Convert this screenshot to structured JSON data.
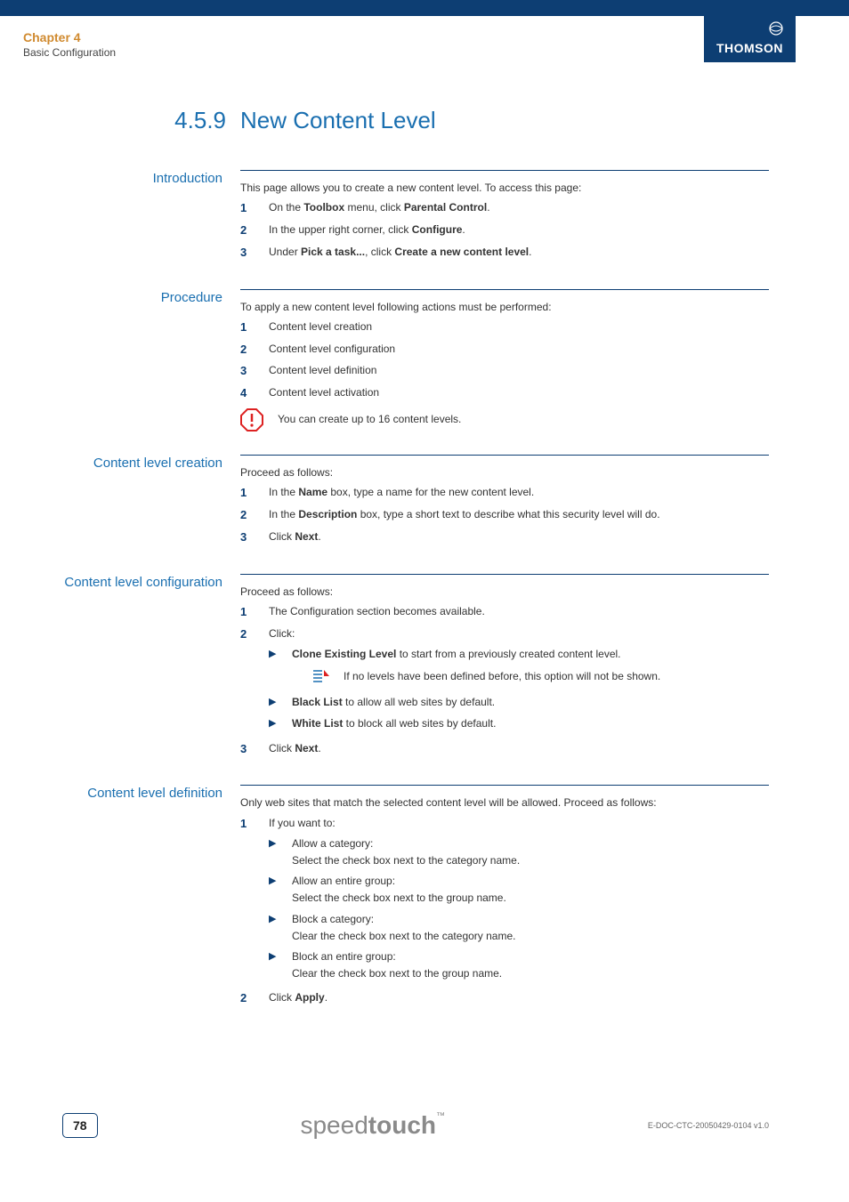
{
  "header": {
    "chapter": "Chapter 4",
    "subtitle": "Basic Configuration",
    "brand": "THOMSON"
  },
  "title": {
    "number": "4.5.9",
    "text": "New Content Level"
  },
  "sections": {
    "introduction": {
      "label": "Introduction",
      "intro": "This page allows you to create a new content level. To access this page:",
      "steps": [
        {
          "n": "1",
          "pre": "On the ",
          "b1": "Toolbox",
          "mid": " menu, click ",
          "b2": "Parental Control",
          "post": "."
        },
        {
          "n": "2",
          "pre": "In the upper right corner, click ",
          "b1": "Configure",
          "post": "."
        },
        {
          "n": "3",
          "pre": "Under ",
          "b1": "Pick a task...",
          "mid": ", click ",
          "b2": "Create a new content level",
          "post": "."
        }
      ]
    },
    "procedure": {
      "label": "Procedure",
      "intro": "To apply a new content level following actions must be performed:",
      "steps": [
        {
          "n": "1",
          "text": "Content level creation"
        },
        {
          "n": "2",
          "text": "Content level configuration"
        },
        {
          "n": "3",
          "text": "Content level definition"
        },
        {
          "n": "4",
          "text": "Content level activation"
        }
      ],
      "note": "You can create up to 16 content levels."
    },
    "creation": {
      "label": "Content level creation",
      "intro": "Proceed as follows:",
      "steps": [
        {
          "n": "1",
          "pre": "In the ",
          "b1": "Name",
          "post": " box, type a name for the new content level."
        },
        {
          "n": "2",
          "pre": "In the ",
          "b1": "Description",
          "post": " box, type a short text to describe what this security level will do."
        },
        {
          "n": "3",
          "pre": "Click ",
          "b1": "Next",
          "post": "."
        }
      ]
    },
    "configuration": {
      "label": "Content level configuration",
      "intro": "Proceed as follows:",
      "step1": {
        "n": "1",
        "text": "The Configuration section becomes available."
      },
      "step2": {
        "n": "2",
        "text": "Click:",
        "bullets": [
          {
            "b": "Clone Existing Level",
            "post": " to start from a previously created content level."
          },
          {
            "b": "Black List",
            "post": " to allow all web sites by default."
          },
          {
            "b": "White List",
            "post": " to block all web sites by default."
          }
        ],
        "note": "If no levels have been defined before, this option will not be shown."
      },
      "step3": {
        "n": "3",
        "pre": "Click ",
        "b1": "Next",
        "post": "."
      }
    },
    "definition": {
      "label": "Content level definition",
      "intro": "Only web sites that match the selected content level will be allowed. Proceed as follows:",
      "step1": {
        "n": "1",
        "text": "If you want to:",
        "bullets": [
          {
            "line1": "Allow a category:",
            "line2": "Select the check box next to the category name."
          },
          {
            "line1": "Allow an entire group:",
            "line2": "Select the check box next to the group name."
          },
          {
            "line1": "Block a category:",
            "line2": "Clear the check box next to the category name."
          },
          {
            "line1": "Block an entire group:",
            "line2": "Clear the check box next to the group name."
          }
        ]
      },
      "step2": {
        "n": "2",
        "pre": "Click ",
        "b1": "Apply",
        "post": "."
      }
    }
  },
  "footer": {
    "page": "78",
    "logo_pre": "speed",
    "logo_bold": "touch",
    "logo_tm": "™",
    "docid": "E-DOC-CTC-20050429-0104 v1.0"
  }
}
